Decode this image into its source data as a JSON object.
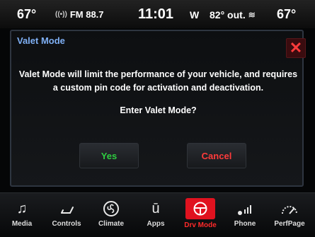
{
  "status": {
    "temp_left": "67°",
    "radio": "FM 88.7",
    "time": "11:01",
    "compass": "W",
    "outside_temp": "82° out.",
    "temp_right": "67°"
  },
  "dialog": {
    "title": "Valet Mode",
    "message": "Valet Mode will limit the performance of your vehicle, and requires a custom pin code for activation and deactivation.",
    "question": "Enter Valet Mode?",
    "yes_label": "Yes",
    "cancel_label": "Cancel",
    "close_icon": "close-icon"
  },
  "dock": {
    "items": [
      {
        "label": "Media",
        "icon": "music-note-icon"
      },
      {
        "label": "Controls",
        "icon": "seat-icon"
      },
      {
        "label": "Climate",
        "icon": "fan-icon"
      },
      {
        "label": "Apps",
        "icon": "apps-icon"
      },
      {
        "label": "Drv Mode",
        "icon": "steering-wheel-icon"
      },
      {
        "label": "Phone",
        "icon": "phone-icon"
      },
      {
        "label": "PerfPage",
        "icon": "gauge-icon"
      }
    ],
    "active_item": "Drv Mode"
  },
  "colors": {
    "accent_title": "#7fb0f5",
    "yes": "#2ecc40",
    "cancel": "#ff3b3b",
    "active_tab": "#e0121f"
  }
}
